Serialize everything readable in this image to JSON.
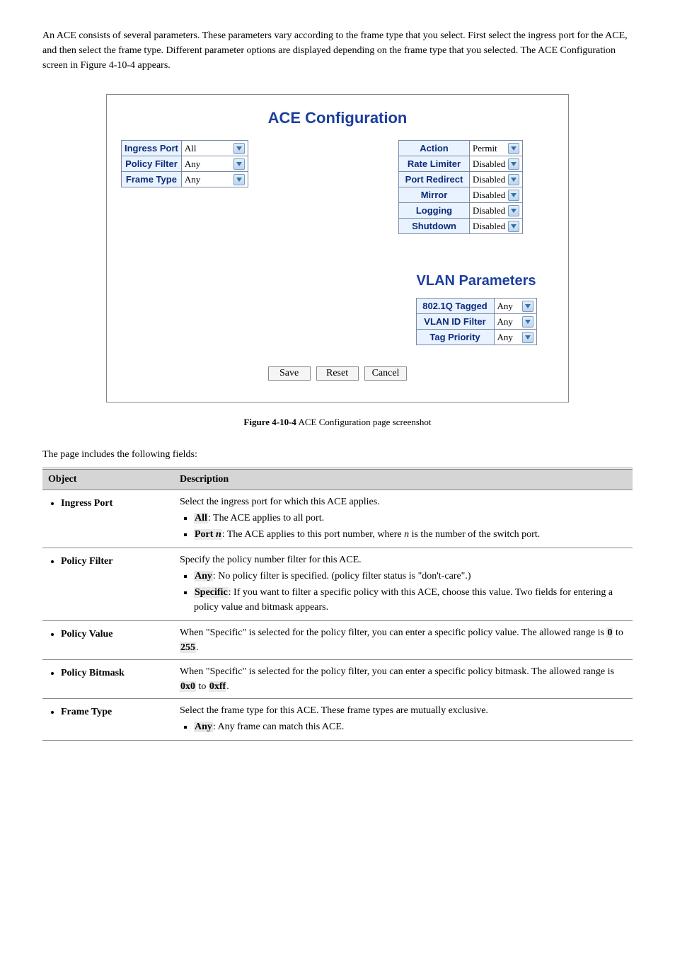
{
  "intro": {
    "p1": "An ACE consists of several parameters. These parameters vary according to the frame type that you select. First select the ingress port for the ACE, and then select the frame type. Different parameter options are displayed depending on the frame type that you selected. The ACE Configuration screen in Figure 4-10-4 appears."
  },
  "screenshot": {
    "title": "ACE Configuration",
    "left_rows": [
      [
        "Ingress Port",
        "All",
        "w1"
      ],
      [
        "Policy Filter",
        "Any",
        "w2"
      ],
      [
        "Frame Type",
        "Any",
        "w2"
      ]
    ],
    "right_rows": [
      [
        "Action",
        "Permit"
      ],
      [
        "Rate Limiter",
        "Disabled"
      ],
      [
        "Port Redirect",
        "Disabled"
      ],
      [
        "Mirror",
        "Disabled"
      ],
      [
        "Logging",
        "Disabled"
      ],
      [
        "Shutdown",
        "Disabled"
      ]
    ],
    "vlan_title": "VLAN Parameters",
    "vlan_rows": [
      [
        "802.1Q Tagged",
        "Any"
      ],
      [
        "VLAN ID Filter",
        "Any"
      ],
      [
        "Tag Priority",
        "Any"
      ]
    ],
    "buttons": [
      "Save",
      "Reset",
      "Cancel"
    ]
  },
  "figcap": {
    "b": "Figure 4-10-4",
    "t": " ACE Configuration page screenshot"
  },
  "desc_line": "The page includes the following fields:",
  "desc_header": [
    "Object",
    "Description"
  ],
  "desc_rows": [
    {
      "obj": "Ingress Port",
      "html": "Select the ingress port for which this ACE applies.<ul class='i'><li><span class='hl bold'>All</span>: The ACE applies to all port.</li><li><span class='hl bold'>Port <i>n</i></span>: The ACE applies to this port number, where <i>n</i> is the number of the switch port.</li></ul>"
    },
    {
      "obj": "Policy Filter",
      "html": "Specify the policy number filter for this ACE.<ul class='i'><li><span class='hl bold'>Any</span>: No policy filter is specified. (policy filter status is \"don't-care\".)</li><li><span class='hl bold'>Specific</span>: If you want to filter a specific policy with this ACE, choose this value. Two fields for entering a policy value and bitmask appears.</li></ul>"
    },
    {
      "obj": "Policy Value",
      "html": "When \"Specific\" is selected for the policy filter, you can enter a specific policy value. The allowed range is <span class='hl bold'>0</span> to <span class='hl bold'>255</span>."
    },
    {
      "obj": "Policy Bitmask",
      "html": "When \"Specific\" is selected for the policy filter, you can enter a specific policy bitmask. The allowed range is <span class='hl bold'>0x0</span> to <span class='hl bold'>0xff</span>."
    },
    {
      "obj": "Frame Type",
      "html": "Select the frame type for this ACE. These frame types are mutually exclusive.<ul class='i'><li><span class='hl bold'>Any</span>: Any frame can match this ACE.</li></ul>"
    }
  ]
}
